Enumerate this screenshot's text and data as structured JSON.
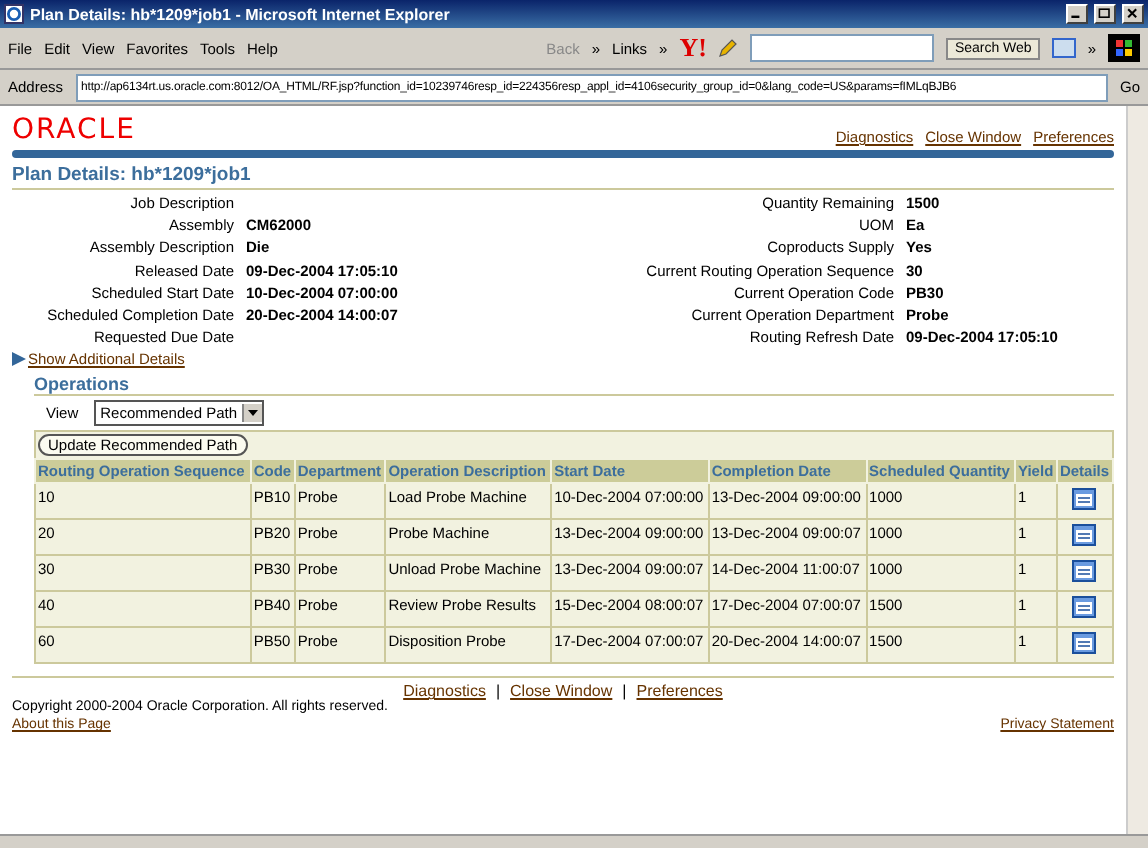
{
  "window": {
    "title": "Plan Details: hb*1209*job1 - Microsoft Internet Explorer"
  },
  "menu": [
    "File",
    "Edit",
    "View",
    "Favorites",
    "Tools",
    "Help"
  ],
  "toolbar": {
    "back": "Back",
    "more": "»",
    "links": "Links",
    "links_more": "»",
    "yahoo": "Y!",
    "search_button": "Search Web",
    "end_more": "»"
  },
  "address": {
    "label": "Address",
    "url": "http://ap6134rt.us.oracle.com:8012/OA_HTML/RF.jsp?function_id=10239746resp_id=224356resp_appl_id=4106security_group_id=0&lang_code=US&params=fIMLqBJB6",
    "go": "Go"
  },
  "header": {
    "logo": "ORACLE",
    "global_links": [
      "Diagnostics",
      "Close Window",
      "Preferences"
    ]
  },
  "page_title": "Plan Details: hb*1209*job1",
  "details_left": [
    {
      "label": "Job Description"
    },
    {
      "label": "Assembly",
      "value": "CM62000"
    },
    {
      "label": "Assembly Description",
      "value": "Die"
    },
    {
      "label": "Released Date",
      "value": "09-Dec-2004 17:05:10"
    },
    {
      "label": "Scheduled Start Date",
      "value": "10-Dec-2004 07:00:00"
    },
    {
      "label": "Scheduled Completion Date",
      "value": "20-Dec-2004 14:00:07"
    },
    {
      "label": "Requested Due Date"
    }
  ],
  "details_right": [
    {
      "label": "Quantity Remaining",
      "value": "1500"
    },
    {
      "label": "UOM",
      "value": "Ea"
    },
    {
      "label": "Coproducts Supply",
      "value": "Yes"
    },
    {
      "label": "Current Routing Operation Sequence",
      "value": "30"
    },
    {
      "label": "Current Operation Code",
      "value": "PB30"
    },
    {
      "label": "Current Operation Department",
      "value": "Probe"
    },
    {
      "label": "Routing Refresh Date",
      "value": "09-Dec-2004 17:05:10"
    }
  ],
  "show_details": "Show Additional Details",
  "operations": {
    "title": "Operations",
    "view_label": "View",
    "view_value": "Recommended Path",
    "button": "Update Recommended Path",
    "columns": [
      "Routing Operation Sequence",
      "Code",
      "Department",
      "Operation Description",
      "Start Date",
      "Completion Date",
      "Scheduled Quantity",
      "Yield",
      "Details"
    ],
    "rows": [
      {
        "cells": [
          "10",
          "PB10",
          "Probe",
          "Load Probe Machine",
          "10-Dec-2004 07:00:00",
          "13-Dec-2004 09:00:00",
          "1000",
          "1"
        ]
      },
      {
        "cells": [
          "20",
          "PB20",
          "Probe",
          "Probe Machine",
          "13-Dec-2004 09:00:00",
          "13-Dec-2004 09:00:07",
          "1000",
          "1"
        ]
      },
      {
        "cells": [
          "30",
          "PB30",
          "Probe",
          "Unload Probe Machine",
          "13-Dec-2004 09:00:07",
          "14-Dec-2004 11:00:07",
          "1000",
          "1"
        ]
      },
      {
        "cells": [
          "40",
          "PB40",
          "Probe",
          "Review Probe Results",
          "15-Dec-2004 08:00:07",
          "17-Dec-2004 07:00:07",
          "1500",
          "1"
        ]
      },
      {
        "cells": [
          "60",
          "PB50",
          "Probe",
          "Disposition Probe",
          "17-Dec-2004 07:00:07",
          "20-Dec-2004 14:00:07",
          "1500",
          "1"
        ]
      }
    ]
  },
  "footer": {
    "links": [
      "Diagnostics",
      "Close Window",
      "Preferences"
    ],
    "separator": "|",
    "copyright": "Copyright 2000-2004 Oracle Corporation. All rights reserved.",
    "about": "About this Page",
    "privacy": "Privacy Statement"
  }
}
